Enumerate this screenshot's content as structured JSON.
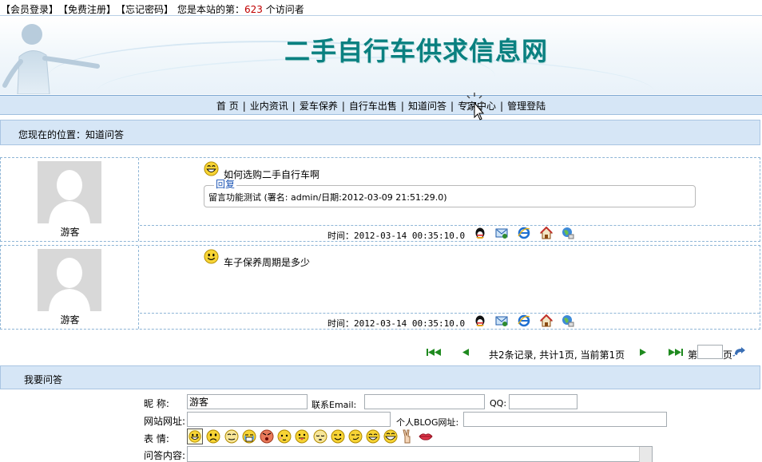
{
  "topbar": {
    "login": "【会员登录】",
    "register": "【免费注册】",
    "forgot": "【忘记密码】",
    "visits_prefix": "您是本站的第：",
    "visits_count": "623",
    "visits_suffix": " 个访问者"
  },
  "banner": {
    "title": "二手自行车供求信息网"
  },
  "nav": {
    "items": [
      "首 页",
      "业内资讯",
      "爱车保养",
      "自行车出售",
      "知道问答",
      "专家中心",
      "管理登陆"
    ],
    "separator": "|"
  },
  "location": {
    "text": "您现在的位置：知道问答"
  },
  "posts": [
    {
      "user": "游客",
      "question": "如何选购二手自行车啊",
      "reply_legend": "回复",
      "reply_text": "留言功能测试 (署名: admin/日期:2012-03-09 21:51:29.0)",
      "time_label": "时间：",
      "time": "2012-03-14 00:35:10.0"
    },
    {
      "user": "游客",
      "question": "车子保养周期是多少",
      "time_label": "时间：",
      "time": "2012-03-14 00:35:10.0"
    }
  ],
  "action_icons": [
    "qq-icon",
    "message-icon",
    "ie-browser-icon",
    "home-icon",
    "network-icon"
  ],
  "pager": {
    "info": "共2条记录, 共计1页, 当前第1页",
    "page_prefix": "第",
    "page_suffix": "页",
    "page_value": ""
  },
  "ask": {
    "title": "我要问答",
    "nickname_label": "昵    称:",
    "nickname_value": "游客",
    "email_label": "联系Email:",
    "email_value": "",
    "qq_label": "QQ:",
    "qq_value": "",
    "website_label": "网站网址:",
    "website_value": "",
    "blog_label": "个人BLOG网址:",
    "blog_value": "",
    "expression_label": "表    情:",
    "content_label": "问答内容:"
  },
  "colors": {
    "bar_bg": "#d6e6f6",
    "title_teal": "#0a8080",
    "count_red": "#c00000",
    "legend_blue": "#1b54b5"
  }
}
